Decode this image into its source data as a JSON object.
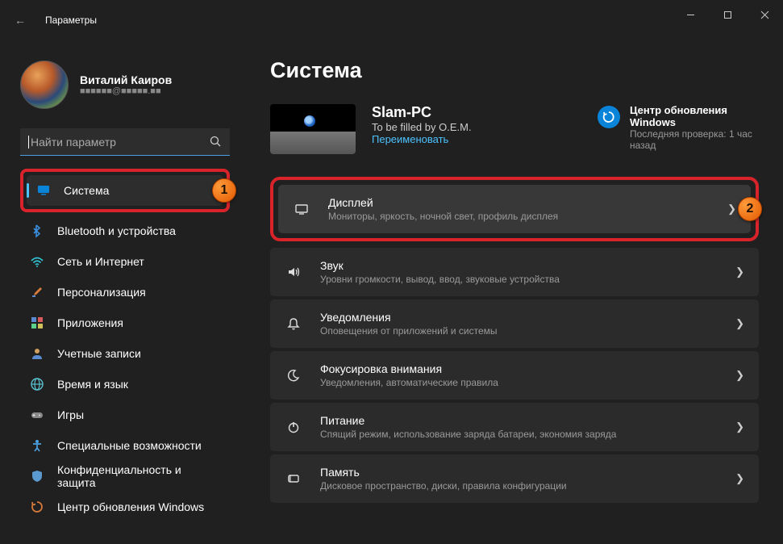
{
  "titlebar": {
    "title": "Параметры"
  },
  "profile": {
    "name": "Виталий Каиров",
    "email": "■■■■■■@■■■■■.■■"
  },
  "search": {
    "placeholder": "Найти параметр"
  },
  "nav": [
    {
      "label": "Система",
      "icon": "monitor",
      "selected": true,
      "highlight": true,
      "badge": "1"
    },
    {
      "label": "Bluetooth и устройства",
      "icon": "bluetooth"
    },
    {
      "label": "Сеть и Интернет",
      "icon": "wifi"
    },
    {
      "label": "Персонализация",
      "icon": "brush"
    },
    {
      "label": "Приложения",
      "icon": "apps"
    },
    {
      "label": "Учетные записи",
      "icon": "person"
    },
    {
      "label": "Время и язык",
      "icon": "globe"
    },
    {
      "label": "Игры",
      "icon": "gamepad"
    },
    {
      "label": "Специальные возможности",
      "icon": "accessibility"
    },
    {
      "label": "Конфиденциальность и защита",
      "icon": "shield"
    },
    {
      "label": "Центр обновления Windows",
      "icon": "update"
    }
  ],
  "page": {
    "title": "Система"
  },
  "pc": {
    "name": "Slam-PC",
    "oem": "To be filled by O.E.M.",
    "rename": "Переименовать"
  },
  "update": {
    "title": "Центр обновления Windows",
    "sub": "Последняя проверка: 1 час назад"
  },
  "cards": [
    {
      "title": "Дисплей",
      "sub": "Мониторы, яркость, ночной свет, профиль дисплея",
      "icon": "display",
      "highlight": true,
      "badge": "2"
    },
    {
      "title": "Звук",
      "sub": "Уровни громкости, вывод, ввод, звуковые устройства",
      "icon": "sound"
    },
    {
      "title": "Уведомления",
      "sub": "Оповещения от приложений и системы",
      "icon": "bell"
    },
    {
      "title": "Фокусировка внимания",
      "sub": "Уведомления, автоматические правила",
      "icon": "moon"
    },
    {
      "title": "Питание",
      "sub": "Спящий режим, использование заряда батареи, экономия заряда",
      "icon": "power"
    },
    {
      "title": "Память",
      "sub": "Дисковое пространство, диски, правила конфигурации",
      "icon": "storage"
    }
  ]
}
